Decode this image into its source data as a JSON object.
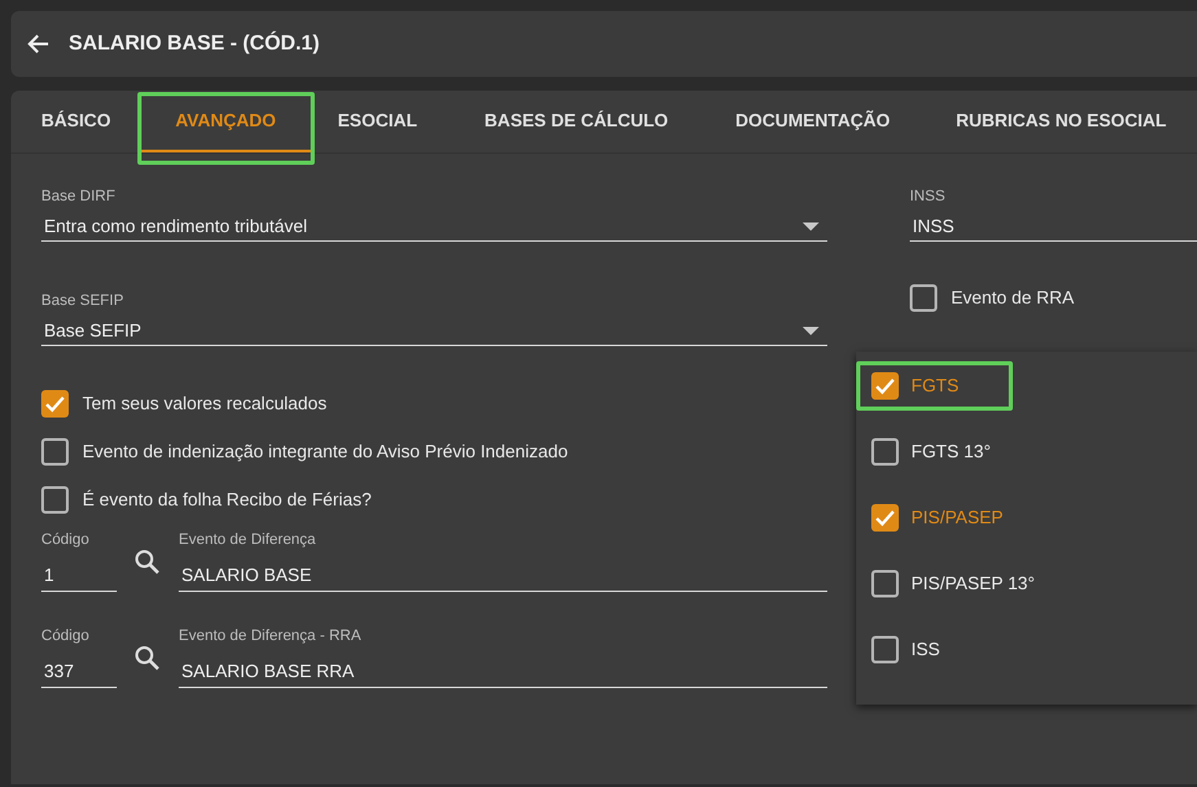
{
  "header": {
    "title": "SALARIO BASE - (CÓD.1)"
  },
  "tabs": [
    {
      "label": "BÁSICO",
      "selected": false,
      "highlighted": false
    },
    {
      "label": "AVANÇADO",
      "selected": true,
      "highlighted": true
    },
    {
      "label": "ESOCIAL",
      "selected": false,
      "highlighted": false
    },
    {
      "label": "BASES DE CÁLCULO",
      "selected": false,
      "highlighted": false
    },
    {
      "label": "DOCUMENTAÇÃO",
      "selected": false,
      "highlighted": false
    },
    {
      "label": "RUBRICAS NO ESOCIAL",
      "selected": false,
      "highlighted": false
    }
  ],
  "selects": [
    {
      "label": "Base DIRF",
      "value": "Entra como rendimento tributável"
    },
    {
      "label": "Base SEFIP",
      "value": "Base SEFIP"
    }
  ],
  "checkboxes": [
    {
      "label": "Tem seus valores recalculados",
      "checked": true
    },
    {
      "label": "Evento de indenização integrante do Aviso Prévio Indenizado",
      "checked": false
    },
    {
      "label": "É evento da folha Recibo de Férias?",
      "checked": false
    }
  ],
  "lookups": [
    {
      "code_label": "Código",
      "code": "1",
      "event_label": "Evento de Diferença",
      "event": "SALARIO BASE"
    },
    {
      "code_label": "Código",
      "code": "337",
      "event_label": "Evento de Diferença - RRA",
      "event": "SALARIO BASE RRA"
    }
  ],
  "inss": {
    "label": "INSS",
    "value": "INSS"
  },
  "rra_checkbox": {
    "label": "Evento de RRA",
    "checked": false
  },
  "dropdown": [
    {
      "label": "FGTS",
      "checked": true,
      "highlighted": true
    },
    {
      "label": "FGTS 13°",
      "checked": false,
      "highlighted": false
    },
    {
      "label": "PIS/PASEP",
      "checked": true,
      "highlighted": false
    },
    {
      "label": "PIS/PASEP 13°",
      "checked": false,
      "highlighted": false
    },
    {
      "label": "ISS",
      "checked": false,
      "highlighted": false
    }
  ]
}
